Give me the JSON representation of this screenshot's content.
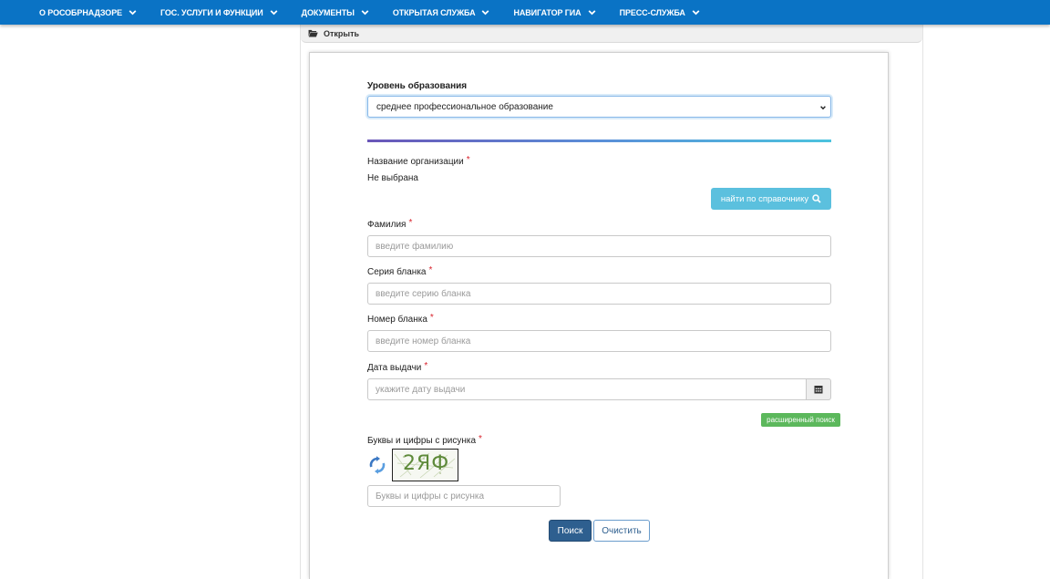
{
  "nav": {
    "items": [
      {
        "label": "О РОСОБРНАДЗОРЕ"
      },
      {
        "label": "ГОС. УСЛУГИ И ФУНКЦИИ"
      },
      {
        "label": "ДОКУМЕНТЫ"
      },
      {
        "label": "ОТКРЫТАЯ СЛУЖБА"
      },
      {
        "label": "НАВИГАТОР ГИА"
      },
      {
        "label": "ПРЕСС-СЛУЖБА"
      }
    ],
    "background": "#0a73c5"
  },
  "panel": {
    "open_label": "Открыть"
  },
  "form": {
    "education_level": {
      "label": "Уровень образования",
      "value": "среднее профессиональное образование"
    },
    "organization": {
      "label": "Название организации",
      "value": "Не выбрана",
      "lookup_button": "найти по справочнику"
    },
    "surname": {
      "label": "Фамилия",
      "placeholder": "введите фамилию"
    },
    "blank_series": {
      "label": "Серия бланка",
      "placeholder": "введите серию бланка"
    },
    "blank_number": {
      "label": "Номер бланка",
      "placeholder": "введите номер бланка"
    },
    "issue_date": {
      "label": "Дата выдачи",
      "placeholder": "укажите дату выдачи"
    },
    "advanced_search": "расширенный поиск",
    "captcha": {
      "label": "Буквы и цифры с рисунка",
      "image_text": "2ЯФ",
      "placeholder": "Буквы и цифры с рисунка"
    },
    "required_mark": "*",
    "search_button": "Поиск",
    "clear_button": "Очистить"
  },
  "colors": {
    "accent_info": "#5bc0de",
    "success": "#5cb85c",
    "primary": "#2e5f8f",
    "required": "#d9232d"
  }
}
